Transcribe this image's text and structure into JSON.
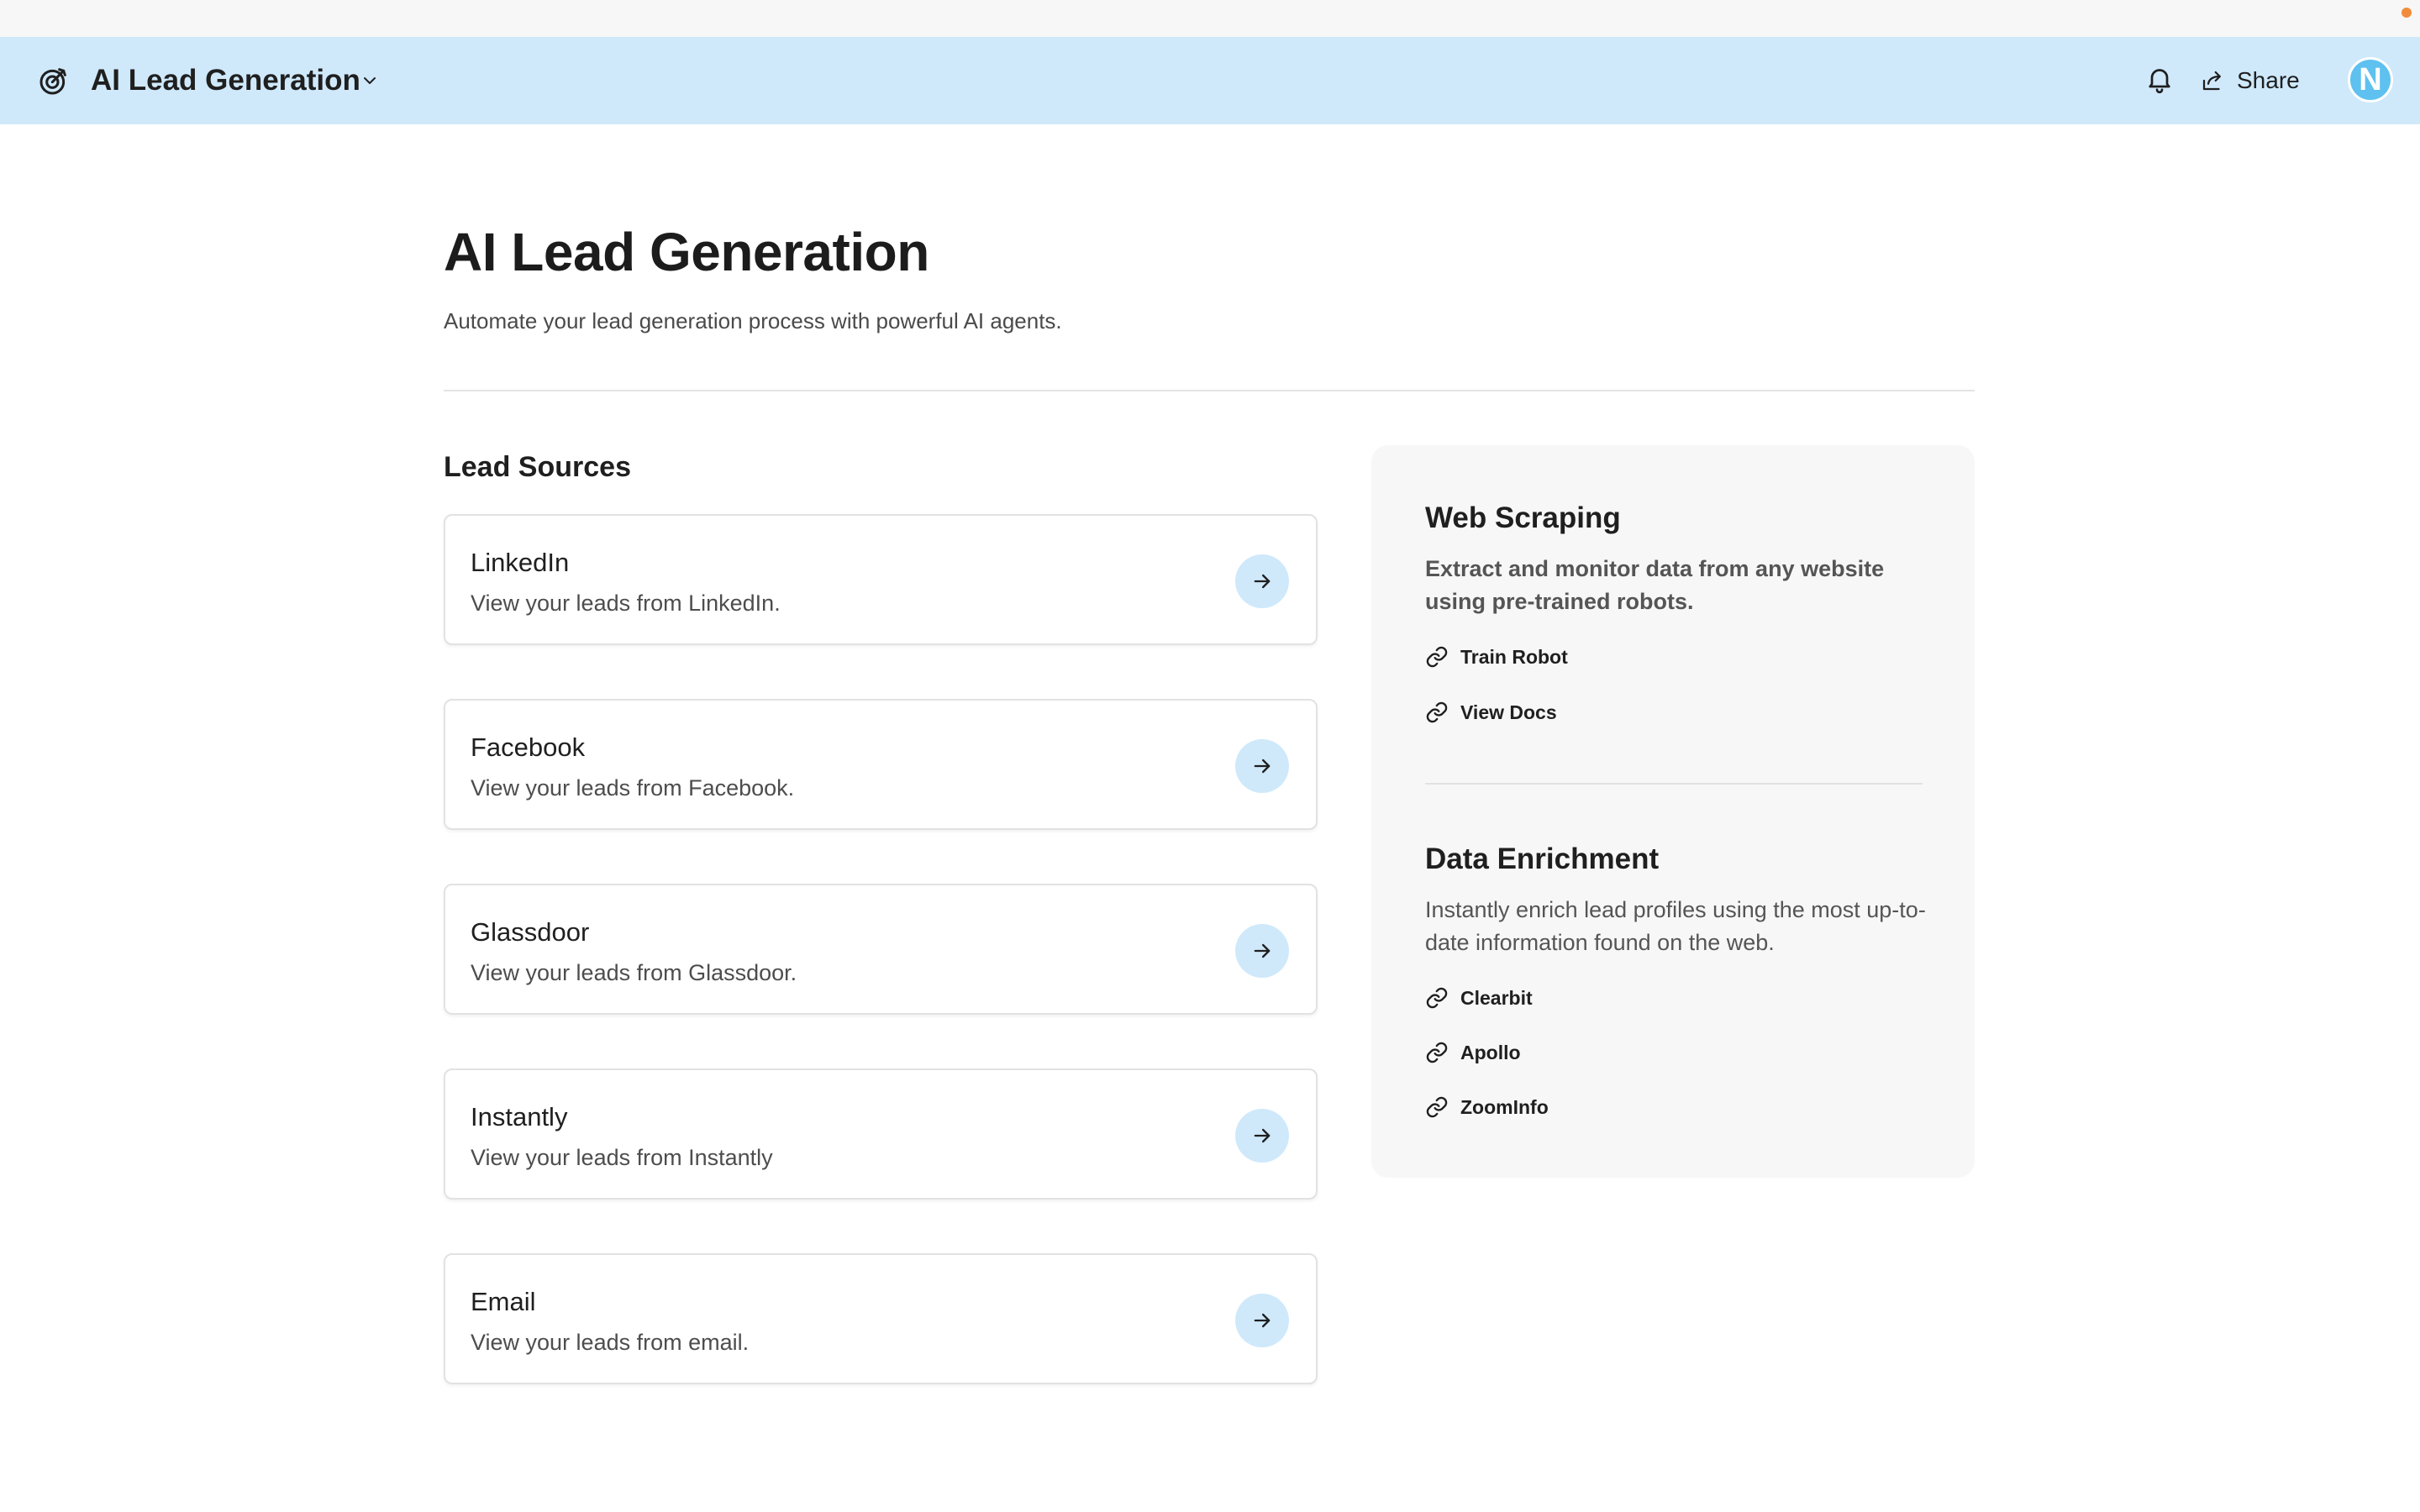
{
  "header": {
    "app_title": "AI Lead Generation",
    "share_label": "Share",
    "avatar_initial": "N",
    "icons": {
      "app": "target-icon",
      "dropdown": "chevron-down-icon",
      "notifications": "bell-icon",
      "share": "share-icon"
    }
  },
  "page": {
    "title": "AI Lead Generation",
    "subtitle": "Automate your lead generation process with powerful AI agents."
  },
  "lead_sources": {
    "heading": "Lead Sources",
    "items": [
      {
        "title": "LinkedIn",
        "description": "View your leads from LinkedIn."
      },
      {
        "title": "Facebook",
        "description": "View your leads from Facebook."
      },
      {
        "title": "Glassdoor",
        "description": "View your leads from Glassdoor."
      },
      {
        "title": "Instantly",
        "description": "View your leads from Instantly"
      },
      {
        "title": "Email",
        "description": "View your leads from email."
      }
    ]
  },
  "side_panel": {
    "web_scraping": {
      "title": "Web Scraping",
      "description": "Extract and monitor data from any website using pre-trained robots.",
      "links": [
        "Train Robot",
        "View Docs"
      ]
    },
    "data_enrichment": {
      "title": "Data Enrichment",
      "description": "Instantly enrich lead profiles using the most up-to-date information found on the web.",
      "links": [
        "Clearbit",
        "Apollo",
        "ZoomInfo"
      ]
    }
  },
  "colors": {
    "header_bg": "#cfe9fb",
    "accent_circle": "#cfe9fb",
    "avatar_bg": "#5fc1ef",
    "panel_bg": "#f7f7f7"
  }
}
